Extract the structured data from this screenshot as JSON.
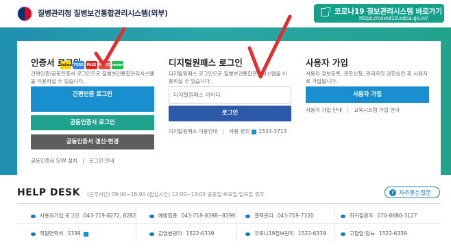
{
  "header": {
    "org_title": "질병관리청 질병보건통합관리시스템(외부)",
    "covid_button_title": "코로나19 정보관리시스템 바로가기",
    "covid_button_url": "https://covid19.kdca.go.kr/"
  },
  "cert_login": {
    "title": "인증서 로그인",
    "description": "간편인증/공동인증서 로그인으로 질병보건통합관리시스템을 이용하실 수 있습니다.",
    "simple_login_label": "간편인증 로그인",
    "joint_cert_login_label": "공동인증서 로그인",
    "renew_label": "공동인증서 갱신·변경",
    "sw_install_link": "공동인증서 S/W 설치",
    "login_guide_link": "로그인 안내",
    "provider_chips": [
      "kakao",
      "TOSS",
      "PASS",
      "PAYCO",
      "naver"
    ]
  },
  "digital_login": {
    "title": "디지털원패스 로그인",
    "description": "디지털원패스 로그인으로 질병보건통합관리시스템을 이용하실 수 있습니다.",
    "id_placeholder": "디지털원패스 아이디",
    "login_button": "로그인",
    "guide_link": "디지털원패스 이용안내",
    "contact_label": "사용 문의",
    "contact_phone": "1533-3713"
  },
  "user_signup": {
    "title": "사용자 가입",
    "description": "사용자 정보등록, 권한신청, 관리자의 권한승인 후 사용자로 가입됩니다.",
    "signup_button": "사용자 가입",
    "signup_guide_link": "사용자 가입 안내",
    "education_guide_link": "교육시스템 가입 안내"
  },
  "help_desk": {
    "title": "HELP DESK",
    "hours": "(근무시간) 09:00~18:00 (점심시간) 12:00~13:00 공휴일·토요일·일요일 휴무",
    "faq_button": "자주묻는질문",
    "contacts": [
      {
        "name": "사용자가입·로그인",
        "phone": "043-719-8272, 8282"
      },
      {
        "name": "예방접종",
        "phone": "043-719-8398~8399"
      },
      {
        "name": "결핵관리",
        "phone": "043-719-7320"
      },
      {
        "name": "희귀질환자",
        "phone": "070-8680-3127"
      },
      {
        "name": "직원연락처",
        "phone": "1339"
      },
      {
        "name": "감염병관리",
        "phone": "1522-6339"
      },
      {
        "name": "코로나19정보관리",
        "phone": "1522-6339"
      },
      {
        "name": "고혈압·당뇨",
        "phone": "1522-6339"
      }
    ]
  },
  "colors": {
    "band_start": "#1f8fb0",
    "band_end": "#22a38c",
    "primary_blue": "#1a8fd0",
    "teal": "#1fa38f",
    "dark_gray": "#5d5d5d",
    "navy": "#2d5aa8",
    "checkmark_red": "#e52b2b"
  }
}
